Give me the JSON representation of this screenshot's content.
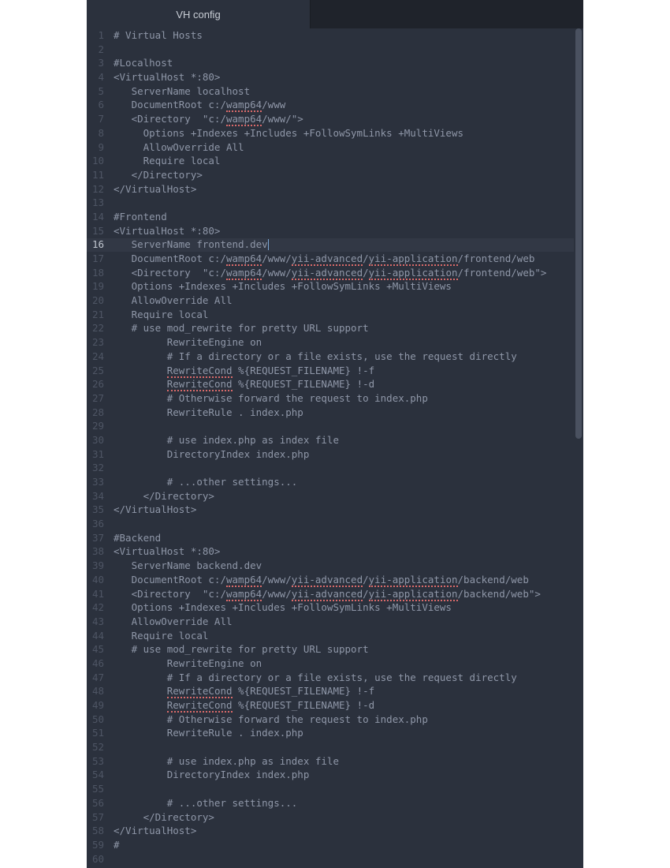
{
  "tab": {
    "title": "VH config"
  },
  "activeLine": 16,
  "gutterStart": 1,
  "lines": [
    {
      "segs": [
        {
          "t": "# Virtual Hosts"
        }
      ]
    },
    {
      "segs": []
    },
    {
      "segs": [
        {
          "t": "#Localhost"
        }
      ]
    },
    {
      "segs": [
        {
          "t": "<VirtualHost *:80>"
        }
      ]
    },
    {
      "segs": [
        {
          "t": "   ServerName localhost"
        }
      ]
    },
    {
      "segs": [
        {
          "t": "   DocumentRoot c:/"
        },
        {
          "t": "wamp64",
          "u": 1
        },
        {
          "t": "/www"
        }
      ]
    },
    {
      "segs": [
        {
          "t": "   <Directory  \"c:/"
        },
        {
          "t": "wamp64",
          "u": 1
        },
        {
          "t": "/www/\">"
        }
      ]
    },
    {
      "segs": [
        {
          "t": "     Options +Indexes +Includes +FollowSymLinks +MultiViews"
        }
      ]
    },
    {
      "segs": [
        {
          "t": "     AllowOverride All"
        }
      ]
    },
    {
      "segs": [
        {
          "t": "     Require local"
        }
      ]
    },
    {
      "segs": [
        {
          "t": "   </Directory>"
        }
      ]
    },
    {
      "segs": [
        {
          "t": "</VirtualHost>"
        }
      ]
    },
    {
      "segs": []
    },
    {
      "segs": [
        {
          "t": "#Frontend"
        }
      ]
    },
    {
      "segs": [
        {
          "t": "<VirtualHost *:80>"
        }
      ]
    },
    {
      "segs": [
        {
          "t": "   ServerName frontend.dev"
        }
      ],
      "cursor": true
    },
    {
      "segs": [
        {
          "t": "   DocumentRoot c:/"
        },
        {
          "t": "wamp64",
          "u": 1
        },
        {
          "t": "/www/"
        },
        {
          "t": "yii-advanced",
          "u": 1
        },
        {
          "t": "/"
        },
        {
          "t": "yii-application",
          "u": 1
        },
        {
          "t": "/frontend/web"
        }
      ]
    },
    {
      "segs": [
        {
          "t": "   <Directory  \"c:/"
        },
        {
          "t": "wamp64",
          "u": 1
        },
        {
          "t": "/www/"
        },
        {
          "t": "yii-advanced",
          "u": 1
        },
        {
          "t": "/"
        },
        {
          "t": "yii-application",
          "u": 1
        },
        {
          "t": "/frontend/web\">"
        }
      ]
    },
    {
      "segs": [
        {
          "t": "   Options +Indexes +Includes +FollowSymLinks +MultiViews"
        }
      ]
    },
    {
      "segs": [
        {
          "t": "   AllowOverride All"
        }
      ]
    },
    {
      "segs": [
        {
          "t": "   Require local"
        }
      ]
    },
    {
      "segs": [
        {
          "t": "   # use mod_rewrite for pretty URL support"
        }
      ]
    },
    {
      "segs": [
        {
          "t": "         RewriteEngine on"
        }
      ]
    },
    {
      "segs": [
        {
          "t": "         # If a directory or a file exists, use the request directly"
        }
      ]
    },
    {
      "segs": [
        {
          "t": "         "
        },
        {
          "t": "RewriteCond",
          "u": 1
        },
        {
          "t": " %{REQUEST_FILENAME} !-f"
        }
      ]
    },
    {
      "segs": [
        {
          "t": "         "
        },
        {
          "t": "RewriteCond",
          "u": 1
        },
        {
          "t": " %{REQUEST_FILENAME} !-d"
        }
      ]
    },
    {
      "segs": [
        {
          "t": "         # Otherwise forward the request to index.php"
        }
      ]
    },
    {
      "segs": [
        {
          "t": "         RewriteRule . index.php"
        }
      ]
    },
    {
      "segs": []
    },
    {
      "segs": [
        {
          "t": "         # use index.php as index file"
        }
      ]
    },
    {
      "segs": [
        {
          "t": "         DirectoryIndex index.php"
        }
      ]
    },
    {
      "segs": []
    },
    {
      "segs": [
        {
          "t": "         # ...other settings..."
        }
      ]
    },
    {
      "segs": [
        {
          "t": "     </Directory>"
        }
      ]
    },
    {
      "segs": [
        {
          "t": "</VirtualHost>"
        }
      ]
    },
    {
      "segs": []
    },
    {
      "segs": [
        {
          "t": "#Backend"
        }
      ]
    },
    {
      "segs": [
        {
          "t": "<VirtualHost *:80>"
        }
      ]
    },
    {
      "segs": [
        {
          "t": "   ServerName backend.dev"
        }
      ]
    },
    {
      "segs": [
        {
          "t": "   DocumentRoot c:/"
        },
        {
          "t": "wamp64",
          "u": 1
        },
        {
          "t": "/www/"
        },
        {
          "t": "yii-advanced",
          "u": 1
        },
        {
          "t": "/"
        },
        {
          "t": "yii-application",
          "u": 1
        },
        {
          "t": "/backend/web"
        }
      ]
    },
    {
      "segs": [
        {
          "t": "   <Directory  \"c:/"
        },
        {
          "t": "wamp64",
          "u": 1
        },
        {
          "t": "/www/"
        },
        {
          "t": "yii-advanced",
          "u": 1
        },
        {
          "t": "/"
        },
        {
          "t": "yii-application",
          "u": 1
        },
        {
          "t": "/backend/web\">"
        }
      ]
    },
    {
      "segs": [
        {
          "t": "   Options +Indexes +Includes +FollowSymLinks +MultiViews"
        }
      ]
    },
    {
      "segs": [
        {
          "t": "   AllowOverride All"
        }
      ]
    },
    {
      "segs": [
        {
          "t": "   Require local"
        }
      ]
    },
    {
      "segs": [
        {
          "t": "   # use mod_rewrite for pretty URL support"
        }
      ]
    },
    {
      "segs": [
        {
          "t": "         RewriteEngine on"
        }
      ]
    },
    {
      "segs": [
        {
          "t": "         # If a directory or a file exists, use the request directly"
        }
      ]
    },
    {
      "segs": [
        {
          "t": "         "
        },
        {
          "t": "RewriteCond",
          "u": 1
        },
        {
          "t": " %{REQUEST_FILENAME} !-f"
        }
      ]
    },
    {
      "segs": [
        {
          "t": "         "
        },
        {
          "t": "RewriteCond",
          "u": 1
        },
        {
          "t": " %{REQUEST_FILENAME} !-d"
        }
      ]
    },
    {
      "segs": [
        {
          "t": "         # Otherwise forward the request to index.php"
        }
      ]
    },
    {
      "segs": [
        {
          "t": "         RewriteRule . index.php"
        }
      ]
    },
    {
      "segs": []
    },
    {
      "segs": [
        {
          "t": "         # use index.php as index file"
        }
      ]
    },
    {
      "segs": [
        {
          "t": "         DirectoryIndex index.php"
        }
      ]
    },
    {
      "segs": []
    },
    {
      "segs": [
        {
          "t": "         # ...other settings..."
        }
      ]
    },
    {
      "segs": [
        {
          "t": "     </Directory>"
        }
      ]
    },
    {
      "segs": [
        {
          "t": "</VirtualHost>"
        }
      ]
    },
    {
      "segs": [
        {
          "t": "#"
        }
      ]
    },
    {
      "segs": []
    }
  ]
}
